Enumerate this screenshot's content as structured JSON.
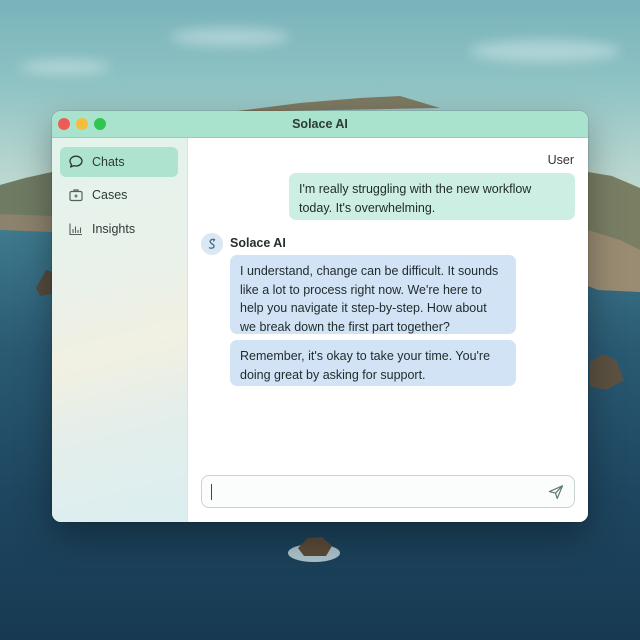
{
  "window": {
    "title": "Solace AI"
  },
  "sidebar": {
    "items": [
      {
        "label": "Chats",
        "icon": "chat-bubble-icon",
        "active": true
      },
      {
        "label": "Cases",
        "icon": "briefcase-icon",
        "active": false
      },
      {
        "label": "Insights",
        "icon": "bar-chart-icon",
        "active": false
      }
    ]
  },
  "chat": {
    "messages": [
      {
        "sender": "User",
        "text": "I'm really struggling with the new workflow today. It's overwhelming."
      },
      {
        "sender": "Solace AI",
        "text": "I understand, change can be difficult. It sounds like a lot to process right now. We're here to help you navigate it step-by-step. How about we break down the first part together?"
      },
      {
        "sender": "Solace AI",
        "text": "Remember, it's okay to take your time. You're doing great by asking for support."
      }
    ]
  },
  "composer": {
    "value": "",
    "send_icon": "send-icon"
  },
  "colors": {
    "titlebar": "#a9e3cd",
    "active_nav": "#aee4cf",
    "user_bubble": "#cdeee2",
    "bot_bubble": "#d2e3f6"
  }
}
